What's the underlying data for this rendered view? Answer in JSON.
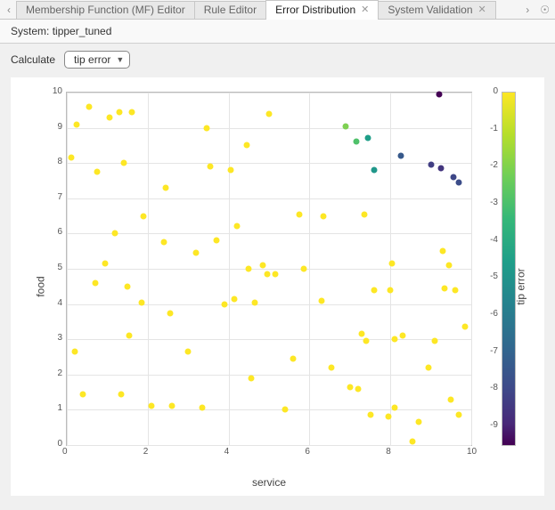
{
  "tabs": {
    "items": [
      {
        "label": "Membership Function (MF) Editor",
        "active": false,
        "closable": false
      },
      {
        "label": "Rule Editor",
        "active": false,
        "closable": false
      },
      {
        "label": "Error Distribution",
        "active": true,
        "closable": true
      },
      {
        "label": "System Validation",
        "active": false,
        "closable": true
      }
    ]
  },
  "header": {
    "system_prefix": "System:",
    "system_name": "tipper_tuned"
  },
  "controls": {
    "calculate_label": "Calculate",
    "selected": "tip error"
  },
  "chart_data": {
    "type": "scatter",
    "xlabel": "service",
    "ylabel": "food",
    "colorbar_label": "tip error",
    "xlim": [
      0,
      10
    ],
    "ylim": [
      0,
      10
    ],
    "clim": [
      -9.5,
      0
    ],
    "xticks": [
      0,
      2,
      4,
      6,
      8,
      10
    ],
    "yticks": [
      0,
      1,
      2,
      3,
      4,
      5,
      6,
      7,
      8,
      9,
      10
    ],
    "cticks": [
      0,
      -1,
      -2,
      -3,
      -4,
      -5,
      -6,
      -7,
      -8,
      -9
    ],
    "points": [
      {
        "x": 0.1,
        "y": 8.15,
        "c": 0
      },
      {
        "x": 0.2,
        "y": 2.65,
        "c": 0
      },
      {
        "x": 0.25,
        "y": 9.1,
        "c": 0
      },
      {
        "x": 0.4,
        "y": 1.45,
        "c": 0
      },
      {
        "x": 0.55,
        "y": 9.6,
        "c": 0
      },
      {
        "x": 0.7,
        "y": 4.6,
        "c": 0
      },
      {
        "x": 0.75,
        "y": 7.75,
        "c": 0
      },
      {
        "x": 0.95,
        "y": 5.15,
        "c": 0
      },
      {
        "x": 1.05,
        "y": 9.3,
        "c": 0
      },
      {
        "x": 1.2,
        "y": 6.0,
        "c": 0
      },
      {
        "x": 1.3,
        "y": 9.45,
        "c": 0
      },
      {
        "x": 1.35,
        "y": 1.45,
        "c": 0
      },
      {
        "x": 1.4,
        "y": 8.0,
        "c": 0
      },
      {
        "x": 1.5,
        "y": 4.5,
        "c": 0
      },
      {
        "x": 1.55,
        "y": 3.1,
        "c": 0
      },
      {
        "x": 1.6,
        "y": 9.45,
        "c": 0
      },
      {
        "x": 1.85,
        "y": 4.05,
        "c": 0
      },
      {
        "x": 1.9,
        "y": 6.5,
        "c": 0
      },
      {
        "x": 2.1,
        "y": 1.1,
        "c": 0
      },
      {
        "x": 2.4,
        "y": 5.75,
        "c": 0
      },
      {
        "x": 2.45,
        "y": 7.3,
        "c": 0
      },
      {
        "x": 2.55,
        "y": 3.75,
        "c": 0
      },
      {
        "x": 2.6,
        "y": 1.1,
        "c": 0
      },
      {
        "x": 3.0,
        "y": 2.65,
        "c": 0
      },
      {
        "x": 3.2,
        "y": 5.45,
        "c": 0
      },
      {
        "x": 3.35,
        "y": 1.05,
        "c": 0
      },
      {
        "x": 3.45,
        "y": 9.0,
        "c": 0
      },
      {
        "x": 3.55,
        "y": 7.9,
        "c": 0
      },
      {
        "x": 3.7,
        "y": 5.8,
        "c": 0
      },
      {
        "x": 3.9,
        "y": 4.0,
        "c": 0
      },
      {
        "x": 4.05,
        "y": 7.8,
        "c": 0
      },
      {
        "x": 4.15,
        "y": 4.15,
        "c": 0
      },
      {
        "x": 4.2,
        "y": 6.2,
        "c": 0
      },
      {
        "x": 4.45,
        "y": 8.5,
        "c": 0
      },
      {
        "x": 4.5,
        "y": 5.0,
        "c": 0
      },
      {
        "x": 4.55,
        "y": 1.9,
        "c": 0
      },
      {
        "x": 4.65,
        "y": 4.05,
        "c": 0
      },
      {
        "x": 4.85,
        "y": 5.1,
        "c": 0
      },
      {
        "x": 4.95,
        "y": 4.85,
        "c": 0
      },
      {
        "x": 5.0,
        "y": 9.4,
        "c": 0
      },
      {
        "x": 5.15,
        "y": 4.85,
        "c": 0
      },
      {
        "x": 5.4,
        "y": 1.0,
        "c": 0
      },
      {
        "x": 5.6,
        "y": 2.45,
        "c": 0
      },
      {
        "x": 5.75,
        "y": 6.55,
        "c": 0
      },
      {
        "x": 5.85,
        "y": 5.0,
        "c": 0
      },
      {
        "x": 6.3,
        "y": 4.1,
        "c": 0
      },
      {
        "x": 6.35,
        "y": 6.5,
        "c": 0
      },
      {
        "x": 6.55,
        "y": 2.2,
        "c": 0
      },
      {
        "x": 7.0,
        "y": 1.65,
        "c": 0
      },
      {
        "x": 7.2,
        "y": 1.6,
        "c": 0
      },
      {
        "x": 7.3,
        "y": 3.15,
        "c": 0
      },
      {
        "x": 7.35,
        "y": 6.55,
        "c": 0
      },
      {
        "x": 7.4,
        "y": 2.95,
        "c": 0
      },
      {
        "x": 7.5,
        "y": 0.85,
        "c": 0
      },
      {
        "x": 7.6,
        "y": 4.4,
        "c": 0
      },
      {
        "x": 7.95,
        "y": 0.8,
        "c": 0
      },
      {
        "x": 8.0,
        "y": 4.4,
        "c": 0
      },
      {
        "x": 8.05,
        "y": 5.15,
        "c": 0
      },
      {
        "x": 8.1,
        "y": 3.0,
        "c": 0
      },
      {
        "x": 8.1,
        "y": 1.05,
        "c": 0
      },
      {
        "x": 8.3,
        "y": 3.1,
        "c": 0
      },
      {
        "x": 8.55,
        "y": 0.1,
        "c": 0
      },
      {
        "x": 8.7,
        "y": 0.65,
        "c": 0
      },
      {
        "x": 8.95,
        "y": 2.2,
        "c": 0
      },
      {
        "x": 9.1,
        "y": 2.95,
        "c": 0
      },
      {
        "x": 9.3,
        "y": 5.5,
        "c": 0
      },
      {
        "x": 9.35,
        "y": 4.45,
        "c": 0
      },
      {
        "x": 9.45,
        "y": 5.1,
        "c": 0
      },
      {
        "x": 9.5,
        "y": 1.3,
        "c": 0
      },
      {
        "x": 9.6,
        "y": 4.4,
        "c": 0
      },
      {
        "x": 9.7,
        "y": 0.85,
        "c": 0
      },
      {
        "x": 9.85,
        "y": 3.35,
        "c": 0
      },
      {
        "x": 6.9,
        "y": 9.05,
        "c": -1.0
      },
      {
        "x": 7.15,
        "y": 8.6,
        "c": -1.8
      },
      {
        "x": 7.45,
        "y": 8.7,
        "c": -3.5
      },
      {
        "x": 7.6,
        "y": 7.8,
        "c": -3.8
      },
      {
        "x": 8.25,
        "y": 8.2,
        "c": -6.5
      },
      {
        "x": 9.0,
        "y": 7.95,
        "c": -7.5
      },
      {
        "x": 9.25,
        "y": 7.85,
        "c": -7.8
      },
      {
        "x": 9.2,
        "y": 9.95,
        "c": -9.5
      },
      {
        "x": 9.7,
        "y": 7.45,
        "c": -7.0
      },
      {
        "x": 9.55,
        "y": 7.6,
        "c": -7.2
      }
    ]
  }
}
